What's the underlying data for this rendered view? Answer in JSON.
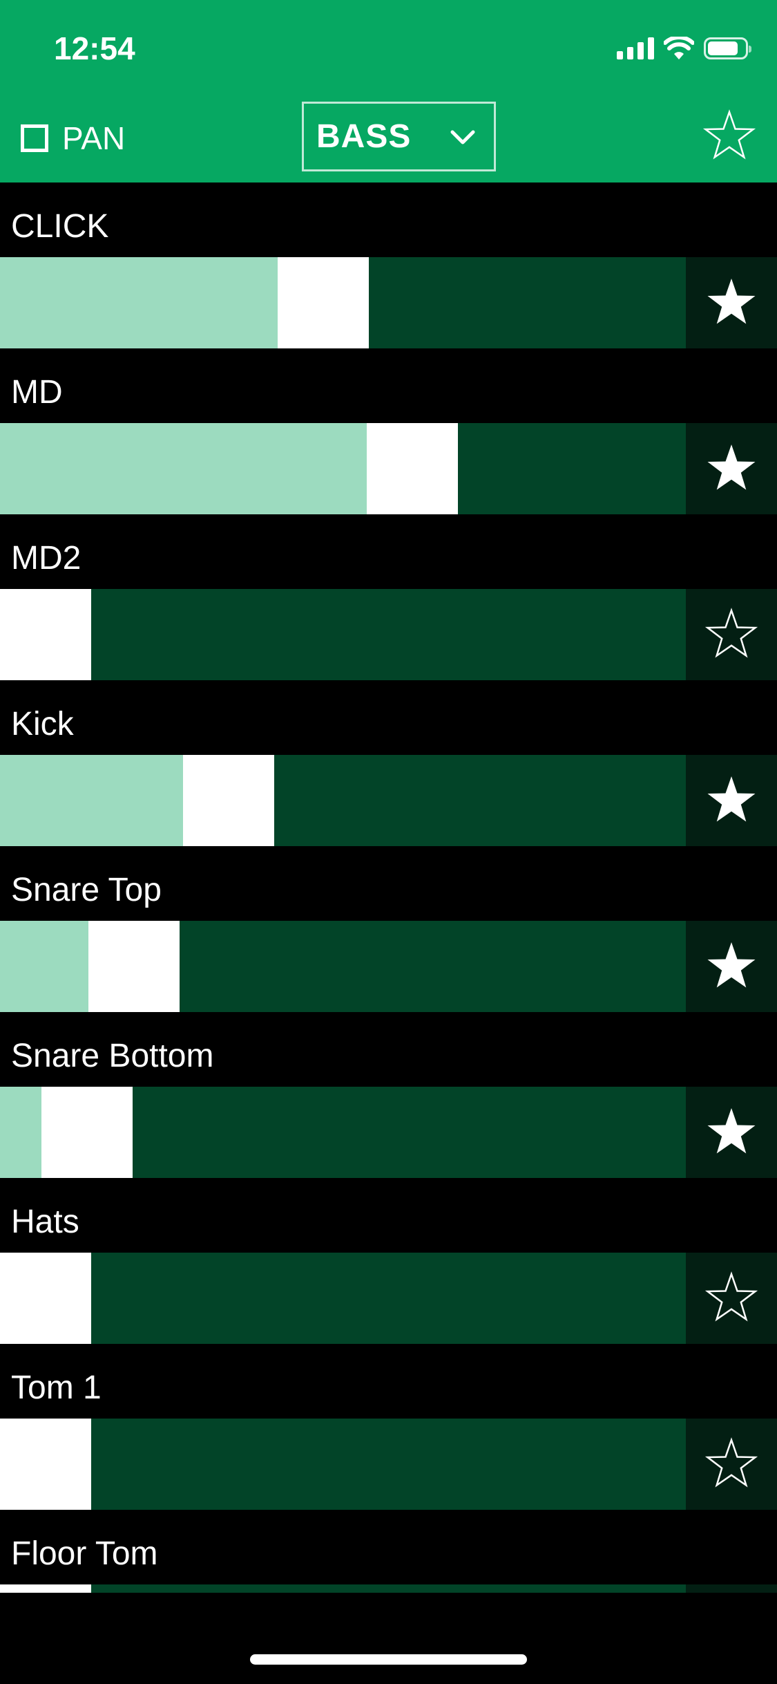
{
  "status_bar": {
    "time": "12:54",
    "battery_level": 0.82,
    "signal_bars": 4
  },
  "header": {
    "pan_label": "PAN",
    "pan_checked": false,
    "mix_select": {
      "value": "BASS",
      "icon": "chevron-down-icon"
    },
    "favorite_icon": "star-outline-icon",
    "background_color": "#06a862"
  },
  "colors": {
    "fader_track": "#024428",
    "fader_fill": "#9cdbbf",
    "fader_handle": "#ffffff",
    "favorite_bg": "#031f13"
  },
  "channels": [
    {
      "name": "CLICK",
      "level": 0.405,
      "favorite": true
    },
    {
      "name": "MD",
      "level": 0.535,
      "favorite": true
    },
    {
      "name": "MD2",
      "level": 0.0,
      "favorite": false
    },
    {
      "name": "Kick",
      "level": 0.267,
      "favorite": true
    },
    {
      "name": "Snare Top",
      "level": 0.129,
      "favorite": true
    },
    {
      "name": "Snare Bottom",
      "level": 0.06,
      "favorite": true
    },
    {
      "name": "Hats",
      "level": 0.0,
      "favorite": false
    },
    {
      "name": "Tom 1",
      "level": 0.0,
      "favorite": false
    },
    {
      "name": "Floor Tom",
      "level": 0.0,
      "favorite": false
    }
  ]
}
